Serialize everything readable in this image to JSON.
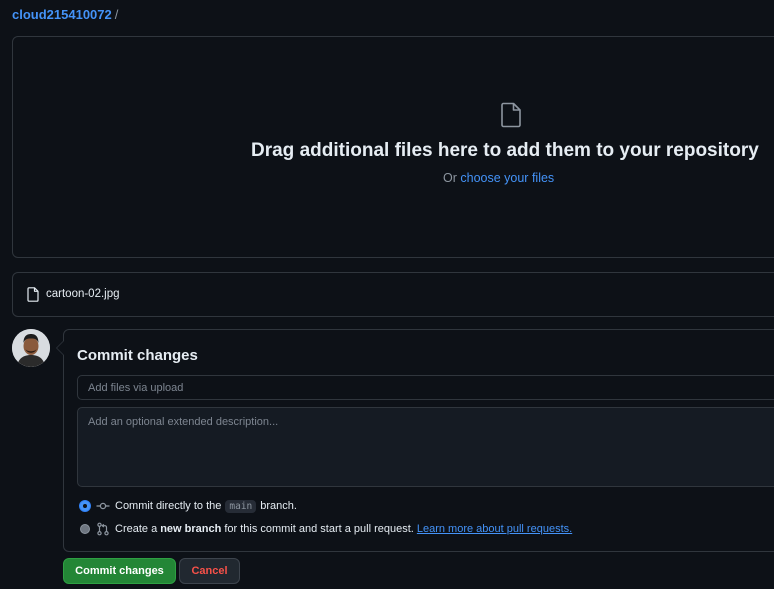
{
  "breadcrumb": {
    "owner": "cloud215410072",
    "separator": "/"
  },
  "dropzone": {
    "icon": "file-icon",
    "headline": "Drag additional files here to add them to your repository",
    "or_text": "Or",
    "choose_link": "choose your files"
  },
  "files": [
    {
      "icon": "file-icon",
      "name": "cartoon-02.jpg"
    }
  ],
  "commit": {
    "title": "Commit changes",
    "summary_placeholder": "Add files via upload",
    "description_placeholder": "Add an optional extended description...",
    "option_direct": {
      "selected": true,
      "icon": "git-commit-icon",
      "prefix": "Commit directly to the",
      "branch": "main",
      "suffix": "branch."
    },
    "option_new_branch": {
      "selected": false,
      "icon": "git-pull-request-icon",
      "prefix": "Create a",
      "bold": "new branch",
      "suffix": "for this commit and start a pull request.",
      "link": "Learn more about pull requests."
    },
    "submit_label": "Commit changes",
    "cancel_label": "Cancel"
  },
  "colors": {
    "background": "#0d1117",
    "link": "#4493f8",
    "primary_button": "#238636",
    "danger_text": "#f85149",
    "border": "#30363d"
  }
}
